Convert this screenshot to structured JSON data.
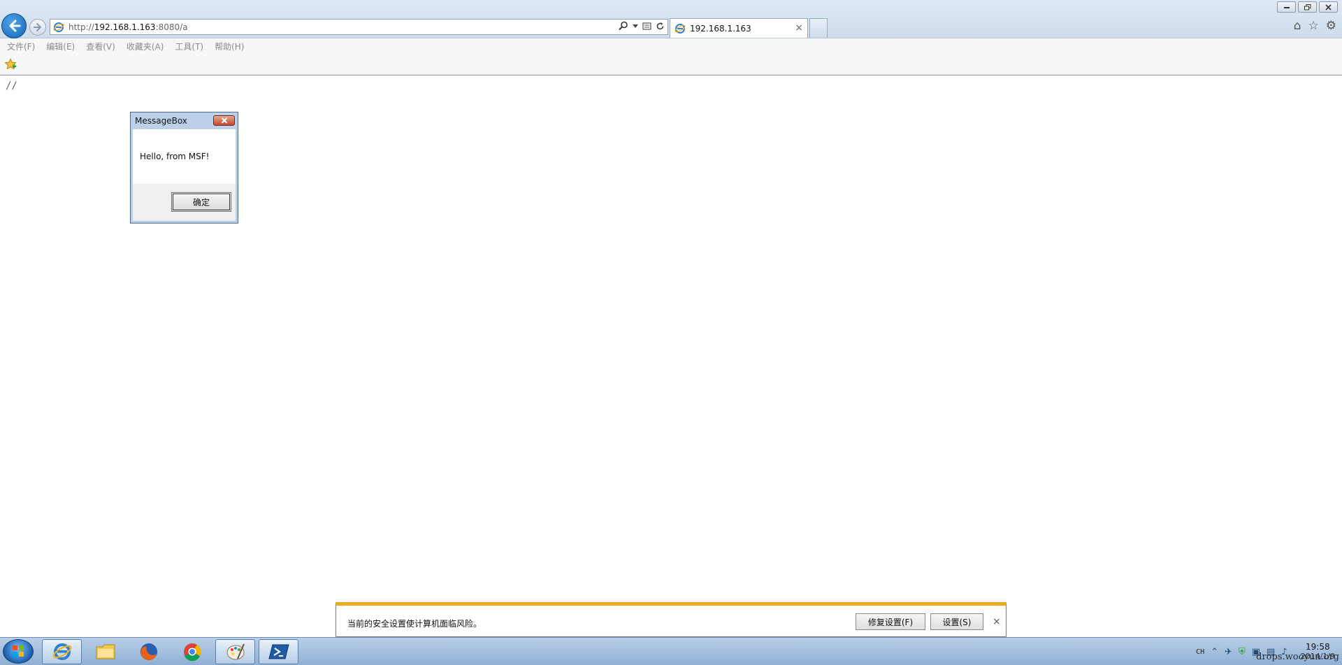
{
  "browser": {
    "url_scheme": "http://",
    "url_host": "192.168.1.163",
    "url_path": ":8080/a",
    "tab_title": "192.168.1.163",
    "tab_close": "×"
  },
  "menu": {
    "items": [
      "文件(F)",
      "编辑(E)",
      "查看(V)",
      "收藏夹(A)",
      "工具(T)",
      "帮助(H)"
    ]
  },
  "page": {
    "comment": "//"
  },
  "message_box": {
    "title": "MessageBox",
    "message": "Hello, from MSF!",
    "ok_label": "确定"
  },
  "notification": {
    "text": "当前的安全设置使计算机面临风险。",
    "fix_label": "修复设置(F)",
    "settings_label": "设置(S)",
    "close": "×"
  },
  "taskbar": {
    "language": "CH",
    "time": "19:58",
    "date": "2014/1/9"
  },
  "watermark": "drops.wooyun.org",
  "colors": {
    "notify_accent": "#f0ad1a",
    "back_button": "#1f75c9",
    "close_red": "#c24a2e"
  }
}
